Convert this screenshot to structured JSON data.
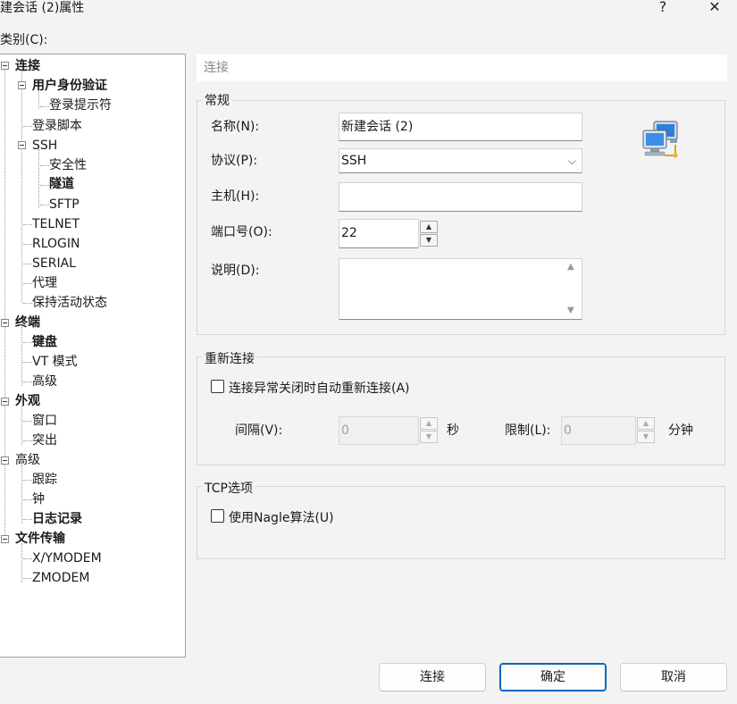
{
  "window": {
    "title": "建会话 (2)属性",
    "help_label": "?",
    "close_label": "✕"
  },
  "category_label": "类别(C):",
  "tree": {
    "items": [
      {
        "label": "连接",
        "bold": true
      },
      {
        "label": "用户身份验证",
        "bold": true
      },
      {
        "label": "登录提示符",
        "bold": false
      },
      {
        "label": "登录脚本",
        "bold": false
      },
      {
        "label": "SSH",
        "bold": false
      },
      {
        "label": "安全性",
        "bold": false
      },
      {
        "label": "隧道",
        "bold": true
      },
      {
        "label": "SFTP",
        "bold": false
      },
      {
        "label": "TELNET",
        "bold": false
      },
      {
        "label": "RLOGIN",
        "bold": false
      },
      {
        "label": "SERIAL",
        "bold": false
      },
      {
        "label": "代理",
        "bold": false
      },
      {
        "label": "保持活动状态",
        "bold": false
      },
      {
        "label": "终端",
        "bold": true
      },
      {
        "label": "键盘",
        "bold": true
      },
      {
        "label": "VT 模式",
        "bold": false
      },
      {
        "label": "高级",
        "bold": false
      },
      {
        "label": "外观",
        "bold": true
      },
      {
        "label": "窗口",
        "bold": false
      },
      {
        "label": "突出",
        "bold": false
      },
      {
        "label": "高级",
        "bold": false
      },
      {
        "label": "跟踪",
        "bold": false
      },
      {
        "label": "钟",
        "bold": false
      },
      {
        "label": "日志记录",
        "bold": true
      },
      {
        "label": "文件传输",
        "bold": true
      },
      {
        "label": "X/YMODEM",
        "bold": false
      },
      {
        "label": "ZMODEM",
        "bold": false
      }
    ]
  },
  "panel": {
    "header": "连接",
    "general": {
      "title": "常规",
      "name_label": "名称(N):",
      "name_value": "新建会话 (2)",
      "protocol_label": "协议(P):",
      "protocol_value": "SSH",
      "host_label": "主机(H):",
      "host_value": "",
      "port_label": "端口号(O):",
      "port_value": "22",
      "desc_label": "说明(D):",
      "desc_value": "",
      "icon": "network-computers-icon"
    },
    "reconnect": {
      "title": "重新连接",
      "checkbox_label": "连接异常关闭时自动重新连接(A)",
      "checked": false,
      "interval_label": "间隔(V):",
      "interval_value": "0",
      "interval_unit": "秒",
      "limit_label": "限制(L):",
      "limit_value": "0",
      "limit_unit": "分钟"
    },
    "tcp": {
      "title": "TCP选项",
      "nagle_label": "使用Nagle算法(U)",
      "checked": false
    }
  },
  "buttons": {
    "connect": "连接",
    "ok": "确定",
    "cancel": "取消"
  },
  "colors": {
    "background": "#f3f3f3",
    "accent": "#0067c0"
  }
}
